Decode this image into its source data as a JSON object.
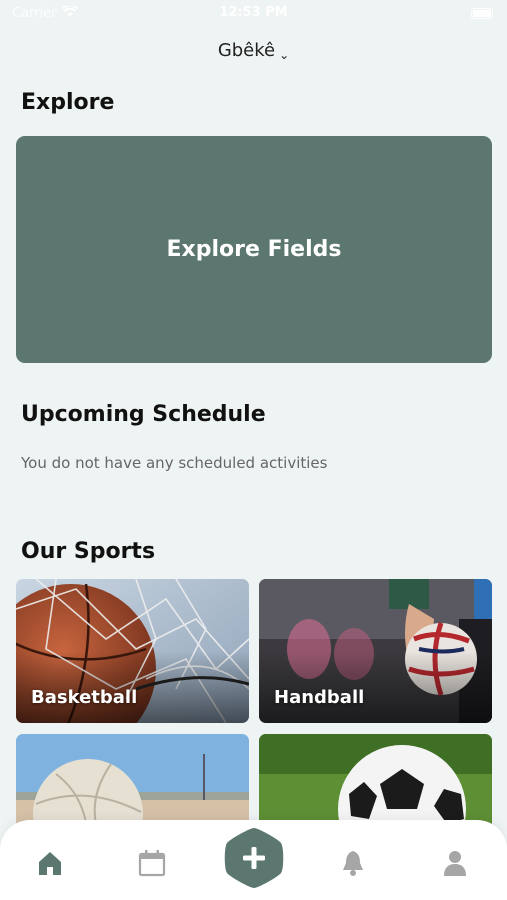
{
  "status_bar": {
    "carrier": "Carrier",
    "time": "12:53 PM"
  },
  "header": {
    "location": "Gbêkê"
  },
  "explore": {
    "title": "Explore",
    "card_label": "Explore Fields"
  },
  "schedule": {
    "title": "Upcoming Schedule",
    "empty_text": "You do not have any scheduled activities"
  },
  "sports": {
    "title": "Our Sports",
    "items": [
      {
        "label": "Basketball"
      },
      {
        "label": "Handball"
      },
      {
        "label": ""
      },
      {
        "label": ""
      }
    ]
  },
  "tabbar": {
    "items": [
      "home-icon",
      "calendar-icon",
      "add-icon",
      "bell-icon",
      "profile-icon"
    ],
    "active_color": "#5b776f",
    "inactive_color": "#a6a6a6"
  },
  "colors": {
    "accent": "#5b776f",
    "background": "#eef3f3"
  }
}
